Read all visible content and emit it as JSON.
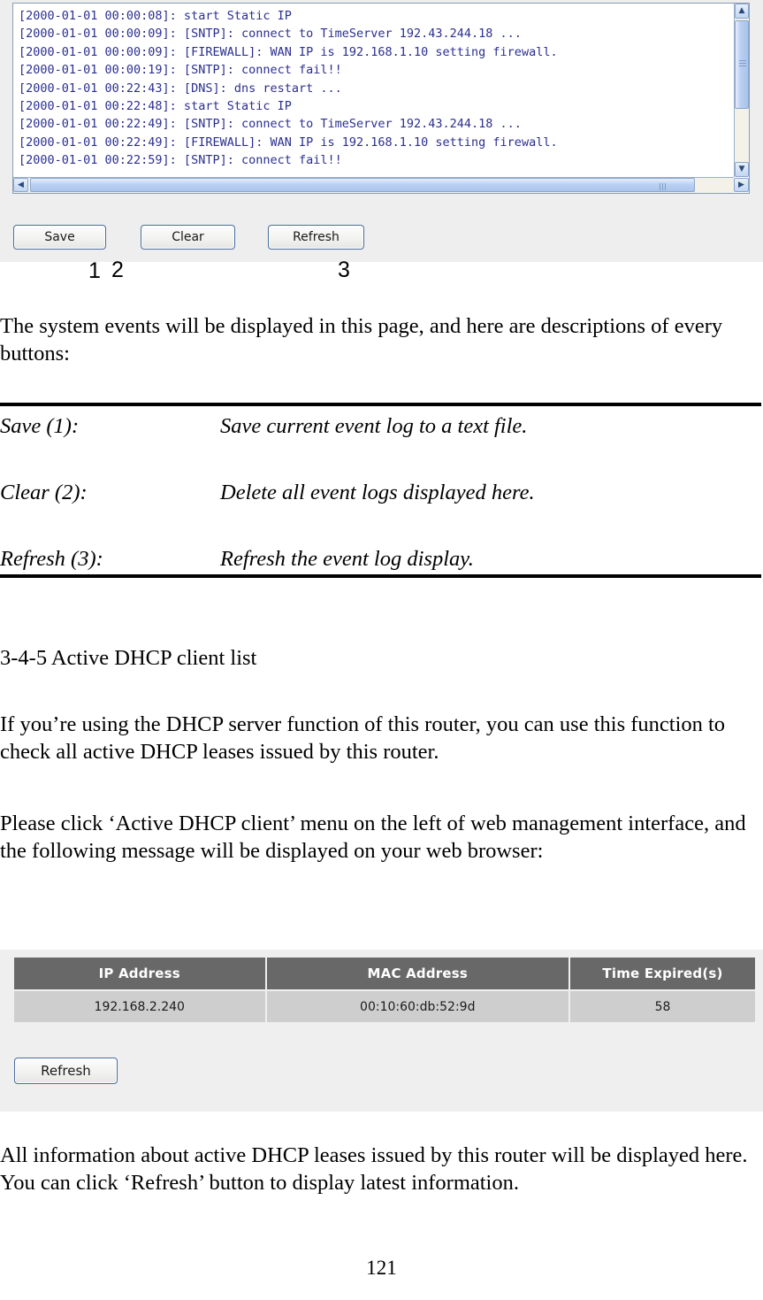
{
  "event_log_screenshot": {
    "log_lines": [
      "[2000-01-01 00:00:08]: start Static IP",
      "[2000-01-01 00:00:09]: [SNTP]: connect to TimeServer 192.43.244.18 ...",
      "[2000-01-01 00:00:09]: [FIREWALL]: WAN IP is 192.168.1.10 setting firewall.",
      "[2000-01-01 00:00:19]: [SNTP]: connect fail!!",
      "[2000-01-01 00:22:43]: [DNS]: dns restart ...",
      "[2000-01-01 00:22:48]: start Static IP",
      "[2000-01-01 00:22:49]: [SNTP]: connect to TimeServer 192.43.244.18 ...",
      "[2000-01-01 00:22:49]: [FIREWALL]: WAN IP is 192.168.1.10 setting firewall.",
      "[2000-01-01 00:22:59]: [SNTP]: connect fail!!"
    ],
    "log_text_color": "#2b2f8f",
    "buttons": {
      "save": "Save",
      "clear": "Clear",
      "refresh": "Refresh"
    },
    "scrollbar": {
      "up_arrow": "▲",
      "down_arrow": "▼",
      "left_arrow": "◀",
      "right_arrow": "▶"
    }
  },
  "callouts": {
    "one": "1",
    "two": "2",
    "three": "3"
  },
  "body": {
    "intro_paragraph": "The system events will be displayed in this page, and here are descriptions of every buttons:",
    "heading_345": "3-4-5 Active DHCP client list",
    "dhcp_paragraph_1": "If you’re using the DHCP server function of this router, you can use this function to check all active DHCP leases issued by this router.",
    "dhcp_paragraph_2": "Please click ‘Active DHCP client’ menu on the left of web management interface, and the following message will be displayed on your web browser:",
    "outro_paragraph": "All information about active DHCP leases issued by this router will be displayed here. You can click ‘Refresh’ button to display latest information."
  },
  "button_descriptions": [
    {
      "term": "Save (1):",
      "definition": "Save current event log to a text file."
    },
    {
      "term": "Clear (2):",
      "definition": "Delete all event logs displayed here."
    },
    {
      "term": "Refresh (3):",
      "definition": "Refresh the event log display."
    }
  ],
  "dhcp_screenshot": {
    "headers": [
      "IP Address",
      "MAC Address",
      "Time Expired(s)"
    ],
    "rows": [
      [
        "192.168.2.240",
        "00:10:60:db:52:9d",
        "58"
      ]
    ],
    "refresh_label": "Refresh",
    "header_bg": "#686868",
    "row_bg": "#cecece"
  },
  "footer": {
    "page_number": "121"
  }
}
